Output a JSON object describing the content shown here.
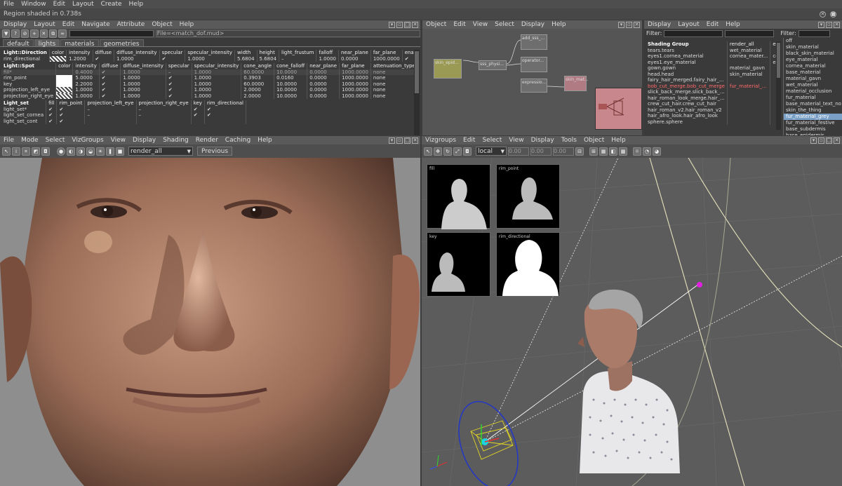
{
  "app": {
    "menu": [
      "File",
      "Window",
      "Edit",
      "Layout",
      "Create",
      "Help"
    ],
    "status": "Region shaded in 0.738s"
  },
  "lights_panel": {
    "menu": [
      "Display",
      "Layout",
      "Edit",
      "Navigate",
      "Attribute",
      "Object",
      "Help"
    ],
    "filter_text": "File=<match_dof.mud>",
    "tabs": [
      "default",
      "lights",
      "materials",
      "geometries"
    ],
    "dir_headers": [
      "Light::Direction",
      "color",
      "intensity",
      "diffuse",
      "diffuse_intensity",
      "specular",
      "specular_intensity",
      "width",
      "height",
      "light_frustum",
      "falloff",
      "near_plane",
      "far_plane",
      "enable_shad"
    ],
    "dir_rows": [
      [
        "rim_directional",
        "",
        "1.2000",
        "✔",
        "1.0000",
        "✔",
        "1.0000",
        "5.6804",
        "5.6804",
        "–",
        "1.0000",
        "0.0000",
        "1000.0000",
        "✔"
      ]
    ],
    "spot_headers": [
      "Light::Spot",
      "color",
      "intensity",
      "diffuse",
      "diffuse_intensity",
      "specular",
      "specular_intensity",
      "cone_angle",
      "cone_falloff",
      "near_plane",
      "far_plane",
      "attenuation_type",
      "enab"
    ],
    "spot_rows": [
      [
        "fill*",
        "",
        "0.4000",
        "✔",
        "1.0000",
        "–",
        "1.0000",
        "60.0000",
        "10.0000",
        "0.0000",
        "1000.0000",
        "none",
        ""
      ],
      [
        "rim_point",
        "",
        "5.0000",
        "✔",
        "1.0000",
        "✔",
        "1.0000",
        "0.3903",
        "0.0160",
        "0.0000",
        "1000.0000",
        "none",
        ""
      ],
      [
        "key",
        "",
        "2.2000",
        "✔",
        "1.0000",
        "✔",
        "1.0000",
        "60.0000",
        "10.0000",
        "0.0000",
        "1000.0000",
        "none",
        ""
      ],
      [
        "projection_left_eye",
        "",
        "1.0000",
        "✔",
        "1.0000",
        "✔",
        "1.0000",
        "2.0000",
        "10.0000",
        "0.0000",
        "1000.0000",
        "none",
        ""
      ],
      [
        "projection_right_eye",
        "",
        "1.0000",
        "✔",
        "1.0000",
        "✔",
        "1.0000",
        "2.0000",
        "10.0000",
        "0.0000",
        "1000.0000",
        "none",
        ""
      ]
    ],
    "set_headers": [
      "Light_set",
      "fill",
      "rim_point",
      "projection_left_eye",
      "projection_right_eye",
      "key",
      "rim_directional"
    ],
    "set_rows": [
      [
        "light_set*",
        "✔",
        "✔",
        "–",
        "–",
        "✔",
        "✔"
      ],
      [
        "light_set_cornea",
        "✔",
        "✔",
        "–",
        "–",
        "✔",
        "✔"
      ],
      [
        "light_set_cont",
        "✔",
        "✔",
        "",
        "",
        "",
        ""
      ]
    ]
  },
  "graph_panel": {
    "menu": [
      "Object",
      "Edit",
      "View",
      "Select",
      "Display",
      "Help"
    ],
    "nodes": [
      "skin_epid...",
      "sss_physi...",
      "add_sss_...",
      "operator...",
      "expressio...",
      "skin_mat..."
    ]
  },
  "shading_panel": {
    "menu": [
      "Display",
      "Layout",
      "Edit",
      "Help"
    ],
    "filter_label": "Filter:",
    "headers": [
      "Shading Group",
      "render_all",
      "eye"
    ],
    "rows": [
      [
        "tears.tears",
        "wet_material",
        ""
      ],
      [
        "eyes1.cornea_material",
        "cornea_mater...",
        "cornea_m"
      ],
      [
        "eyes1.eye_material",
        "",
        "eye_mat"
      ],
      [
        "gown.gown",
        "material_gavn",
        ""
      ],
      [
        "head.head",
        "skin_material",
        ""
      ],
      [
        "fairy_hair_merged.fairy_hair_...",
        "",
        ""
      ],
      [
        "bob_cut_merge.bob_cut_merge",
        "fur_material_...",
        ""
      ],
      [
        "slick_back_merge.slick_back_...",
        "",
        ""
      ],
      [
        "hair_roman_look_merge.hair_...",
        "",
        ""
      ],
      [
        "crew_cut_hair.crew_cut_hair",
        "",
        ""
      ],
      [
        "hair_roman_v2.hair_roman_v2",
        "",
        ""
      ],
      [
        "hair_afro_look.hair_afro_look",
        "",
        ""
      ],
      [
        "sphere.sphere",
        "",
        ""
      ]
    ],
    "filter2_label": "Filter:",
    "materials": [
      "off",
      "skin_material",
      "black_skin_material",
      "eye_material",
      "cornea_material",
      "base_material",
      "material_gavn",
      "wet_material",
      "material_occlusion",
      "fur_material",
      "base_material_text_no",
      "skin_the_thing",
      "fur_material_grey",
      "fur_material_festive",
      "base_subdermis",
      "base_epidermis"
    ],
    "selected_material": "fur_material_grey"
  },
  "render_view": {
    "menu": [
      "File",
      "Mode",
      "Select",
      "VizGroups",
      "View",
      "Display",
      "Shading",
      "Render",
      "Caching",
      "Help"
    ],
    "pass_select": "render_all",
    "previous_label": "Previous"
  },
  "viewport": {
    "menu": [
      "Vizgroups",
      "Edit",
      "Select",
      "View",
      "Display",
      "Tools",
      "Object",
      "Help"
    ],
    "space_select": "local",
    "coords": [
      "0.00",
      "0.00",
      "0.00"
    ],
    "thumbs": [
      "fill",
      "rim_point",
      "key",
      "rim_directional"
    ]
  }
}
